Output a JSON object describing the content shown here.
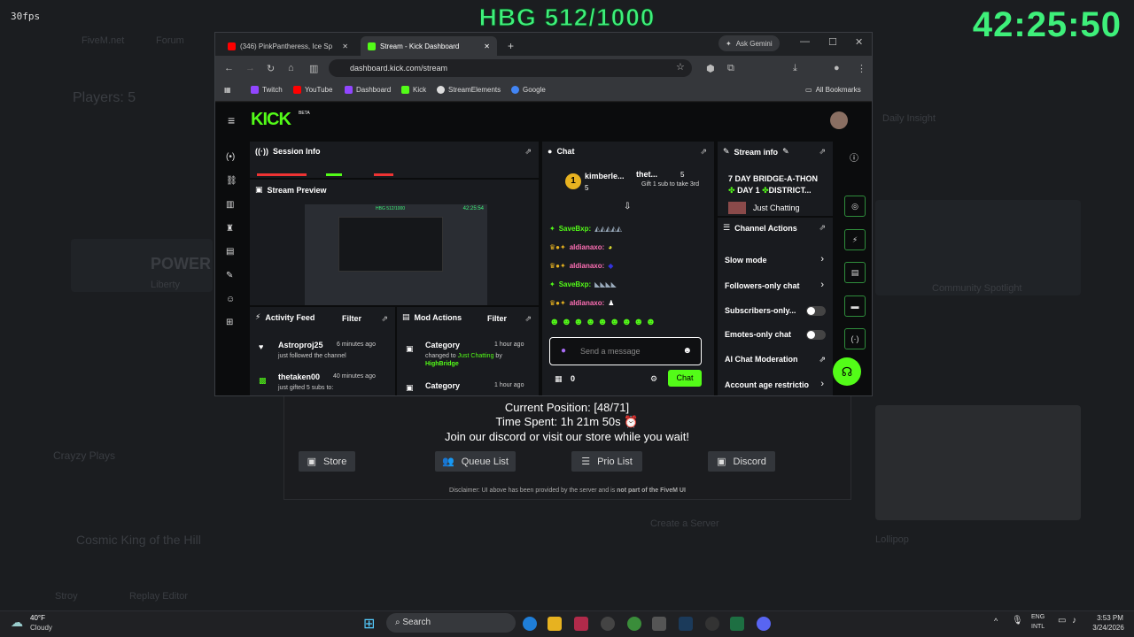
{
  "overlay": {
    "fps": "30fps",
    "hbg": "HBG 512/1000",
    "clock": "42:25:50"
  },
  "background": {
    "items": [
      "FiveM.net",
      "Forum",
      "Players: 5",
      "POWER",
      "Liberty",
      "Crayzy Plays",
      "Cosmic King of the Hill",
      "Daily Insight",
      "Create a Server",
      "Stroy",
      "Replay Editor",
      "Lollipop",
      "Community Spotlight"
    ]
  },
  "queue": {
    "position": "Current Position: [48/71]",
    "time": "Time Spent: 1h 21m 50s ⏰",
    "join": "Join our discord or visit our store while you wait!",
    "buttons": [
      {
        "label": "Store",
        "icon": "store-icon"
      },
      {
        "label": "Queue List",
        "icon": "users-icon"
      },
      {
        "label": "Prio List",
        "icon": "list-icon"
      },
      {
        "label": "Discord",
        "icon": "discord-icon"
      }
    ],
    "disclaimer": "Disclaimer: UI above has been provided by the server and is",
    "disclaimer_bold": "not part of the FiveM UI"
  },
  "browser": {
    "tab1": "(346) PinkPantheress, Ice Sp",
    "tab2": "Stream - Kick Dashboard",
    "gemini": "Ask Gemini",
    "url": "dashboard.kick.com/stream",
    "bookmarks": [
      "Twitch",
      "YouTube",
      "Dashboard",
      "Kick",
      "StreamElements",
      "Google"
    ],
    "all_bookmarks": "All Bookmarks"
  },
  "kick": {
    "logo": "KICK",
    "beta": "BETA",
    "session_info": "Session Info",
    "stream_preview": "Stream Preview",
    "preview_timer": "42:25:54",
    "preview_title": "HBG 512/1000",
    "activity_feed": "Activity Feed",
    "mod_actions": "Mod Actions",
    "filter": "Filter",
    "activity": [
      {
        "user": "Astroproj25",
        "time": "6 minutes ago",
        "text": "just followed the channel"
      },
      {
        "user": "thetaken00",
        "time": "40 minutes ago",
        "text": "just gifted 5 subs to:"
      }
    ],
    "mod": [
      {
        "title": "Category",
        "time": "1 hour ago",
        "text": "changed to",
        "hl": "Just Chatting",
        "by": "by",
        "user": "HighBridge"
      },
      {
        "title": "Category",
        "time": "1 hour ago"
      }
    ],
    "chat": {
      "title": "Chat",
      "top1": {
        "name": "kimberle...",
        "count": "5"
      },
      "top2": {
        "name": "thet...",
        "count": "5",
        "gift": "Gift 1 sub to take 3rd"
      },
      "lines": [
        {
          "name": "SaveBxp:",
          "color": "#53fc18"
        },
        {
          "name": "aldianaxo:",
          "color": "#ff6fb5"
        },
        {
          "name": "aldianaxo:",
          "color": "#ff6fb5"
        },
        {
          "name": "SaveBxp:",
          "color": "#53fc18"
        },
        {
          "name": "aldianaxo:",
          "color": "#ff6fb5"
        }
      ],
      "placeholder": "Send a message",
      "count": "0",
      "send": "Chat"
    },
    "stream_info": {
      "title": "Stream info",
      "name": "7 DAY BRIDGE-A-THON",
      "line2": "DAY 1",
      "line2b": "DISTRICT...",
      "category": "Just Chatting"
    },
    "channel_actions": {
      "title": "Channel Actions",
      "items": [
        "Slow mode",
        "Followers-only chat",
        "Subscribers-only...",
        "Emotes-only chat",
        "AI Chat Moderation",
        "Account age restrictio"
      ]
    }
  },
  "taskbar": {
    "temp": "40°F",
    "weather": "Cloudy",
    "search": "Search",
    "lang1": "ENG",
    "lang2": "INTL",
    "time": "3:53 PM",
    "date": "3/24/2026"
  }
}
